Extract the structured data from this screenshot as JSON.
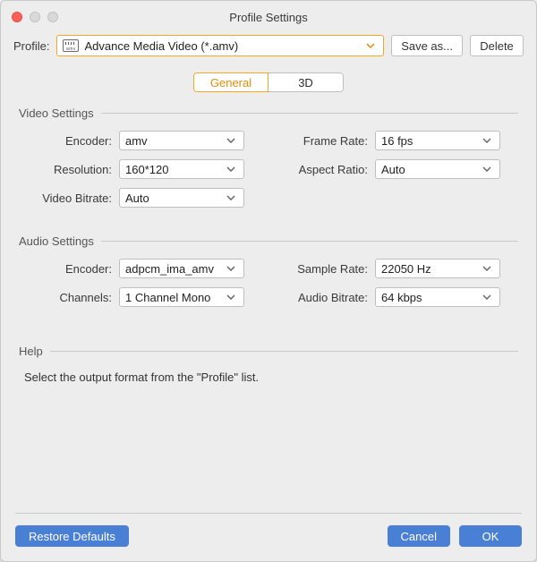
{
  "window": {
    "title": "Profile Settings"
  },
  "header": {
    "profile_label": "Profile:",
    "profile_value": "Advance Media Video (*.amv)",
    "profile_icon_name": "amv",
    "save_as": "Save as...",
    "delete": "Delete"
  },
  "tabs": {
    "general": "General",
    "three_d": "3D",
    "active": "general"
  },
  "video": {
    "title": "Video Settings",
    "encoder_label": "Encoder:",
    "encoder": "amv",
    "frame_rate_label": "Frame Rate:",
    "frame_rate": "16 fps",
    "resolution_label": "Resolution:",
    "resolution": "160*120",
    "aspect_ratio_label": "Aspect Ratio:",
    "aspect_ratio": "Auto",
    "video_bitrate_label": "Video Bitrate:",
    "video_bitrate": "Auto"
  },
  "audio": {
    "title": "Audio Settings",
    "encoder_label": "Encoder:",
    "encoder": "adpcm_ima_amv",
    "sample_rate_label": "Sample Rate:",
    "sample_rate": "22050 Hz",
    "channels_label": "Channels:",
    "channels": "1 Channel Mono",
    "audio_bitrate_label": "Audio Bitrate:",
    "audio_bitrate": "64 kbps"
  },
  "help": {
    "title": "Help",
    "text": "Select the output format from the \"Profile\" list."
  },
  "footer": {
    "restore": "Restore Defaults",
    "cancel": "Cancel",
    "ok": "OK"
  },
  "colors": {
    "accent": "#f5a623",
    "primary_button": "#4a7fd6"
  }
}
